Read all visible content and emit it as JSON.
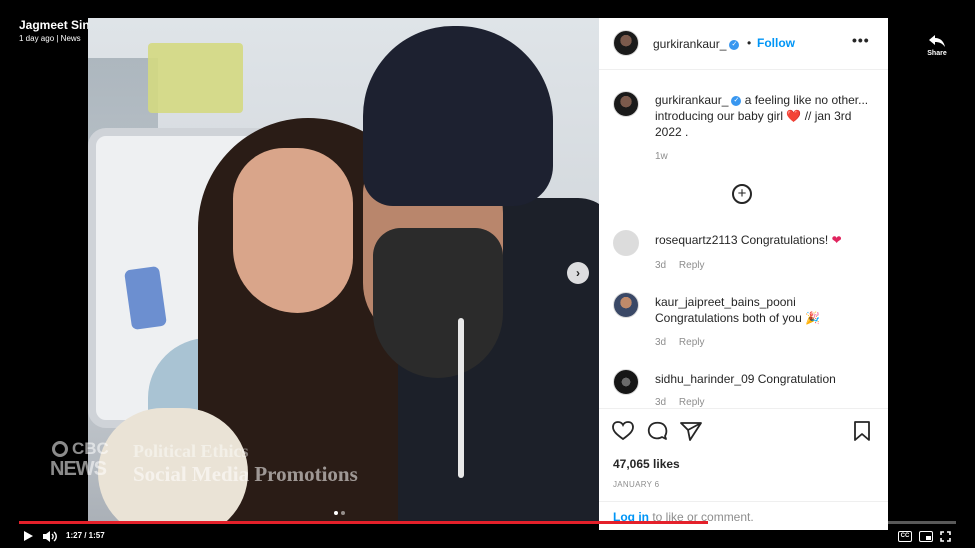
{
  "video": {
    "title": "Jagmeet Singh, wife to pay for rocking chair after ethics backlash",
    "meta": "1 day ago | News",
    "share_label": "Share",
    "time": "1:27 / 1:57",
    "progress_fraction": 0.735
  },
  "watermark": {
    "brand_line1": "CBC",
    "brand_line2": "NEWS",
    "lower_third_1": "Political Ethics",
    "lower_third_2": "Social Media Promotions"
  },
  "instagram": {
    "username": "gurkirankaur_",
    "follow_label": "Follow",
    "dot_separator": "•",
    "more_glyph": "•••",
    "caption_text": "a feeling like no other... introducing our baby girl",
    "caption_heart": "❤️",
    "caption_tail": "// jan 3rd 2022 .",
    "caption_time": "1w",
    "load_more_glyph": "+",
    "comments": [
      {
        "user": "rosequartz2113",
        "text": "Congratulations!",
        "emoji": "❤",
        "age": "3d",
        "reply": "Reply"
      },
      {
        "user": "kaur_jaipreet_bains_pooni",
        "text": "Congratulations both of you",
        "emoji": "🎉",
        "age": "3d",
        "reply": "Reply"
      },
      {
        "user": "sidhu_harinder_09",
        "text": "Congratulation",
        "age": "3d",
        "reply": "Reply"
      }
    ],
    "likes": "47,065 likes",
    "date": "JANUARY 6",
    "login_link": "Log in",
    "login_rest": " to like or comment."
  },
  "colors": {
    "accent_blue": "#0095f6",
    "progress_red": "#e4202a",
    "heart_red": "#e0245e"
  },
  "icons": [
    "share-icon",
    "next-photo-icon",
    "verified-icon",
    "more-icon",
    "add-comments-icon",
    "like-icon",
    "comment-icon",
    "share-post-icon",
    "save-icon",
    "play-icon",
    "volume-icon",
    "captions-icon",
    "pip-icon",
    "fullscreen-icon"
  ]
}
